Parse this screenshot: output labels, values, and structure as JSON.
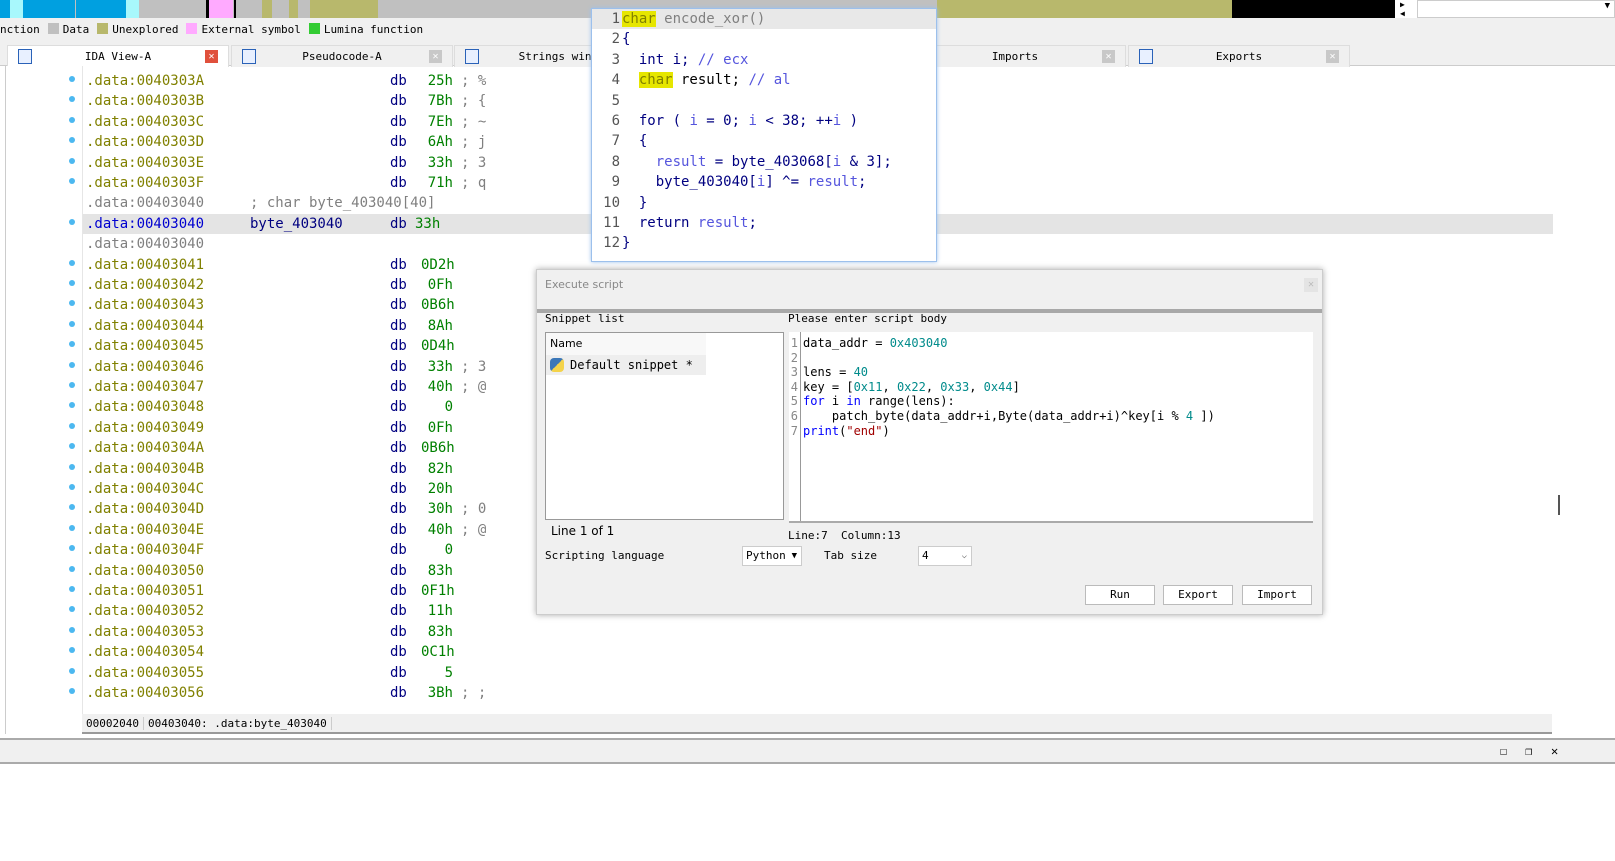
{
  "legend": [
    {
      "label": "nction",
      "color": null
    },
    {
      "label": "Data",
      "color": "#c0c0c0"
    },
    {
      "label": "Unexplored",
      "color": "#b8b86c"
    },
    {
      "label": "External symbol",
      "color": "#ffaaff"
    },
    {
      "label": "Lumina function",
      "color": "#33cc33"
    }
  ],
  "tabs": [
    {
      "label": "IDA View-A",
      "active": true
    },
    {
      "label": "Pseudocode-A"
    },
    {
      "label": "Strings window"
    },
    {
      "label": "Imports"
    },
    {
      "label": "Exports"
    }
  ],
  "listing": [
    {
      "addr": ".data:0040303A",
      "val": "25h",
      "cmt": "; %"
    },
    {
      "addr": ".data:0040303B",
      "val": "7Bh",
      "cmt": "; {"
    },
    {
      "addr": ".data:0040303C",
      "val": "7Eh",
      "cmt": "; ~"
    },
    {
      "addr": ".data:0040303D",
      "val": "6Ah",
      "cmt": "; j"
    },
    {
      "addr": ".data:0040303E",
      "val": "33h",
      "cmt": "; 3"
    },
    {
      "addr": ".data:0040303F",
      "val": "71h",
      "cmt": "; q"
    },
    {
      "addr": ".data:00403040",
      "kind": "comment",
      "text": "; char byte_403040[40]"
    },
    {
      "addr": ".data:00403040",
      "kind": "selected",
      "label": "byte_403040",
      "val": "33h"
    },
    {
      "addr": ".data:00403040",
      "kind": "blank"
    },
    {
      "addr": ".data:00403041",
      "val": "0D2h"
    },
    {
      "addr": ".data:00403042",
      "val": "0Fh"
    },
    {
      "addr": ".data:00403043",
      "val": "0B6h"
    },
    {
      "addr": ".data:00403044",
      "val": "8Ah"
    },
    {
      "addr": ".data:00403045",
      "val": "0D4h"
    },
    {
      "addr": ".data:00403046",
      "val": "33h",
      "cmt": "; 3"
    },
    {
      "addr": ".data:00403047",
      "val": "40h",
      "cmt": "; @"
    },
    {
      "addr": ".data:00403048",
      "val": "0"
    },
    {
      "addr": ".data:00403049",
      "val": "0Fh"
    },
    {
      "addr": ".data:0040304A",
      "val": "0B6h"
    },
    {
      "addr": ".data:0040304B",
      "val": "82h"
    },
    {
      "addr": ".data:0040304C",
      "val": "20h"
    },
    {
      "addr": ".data:0040304D",
      "val": "30h",
      "cmt": "; 0"
    },
    {
      "addr": ".data:0040304E",
      "val": "40h",
      "cmt": "; @"
    },
    {
      "addr": ".data:0040304F",
      "val": "0"
    },
    {
      "addr": ".data:00403050",
      "val": "83h"
    },
    {
      "addr": ".data:00403051",
      "val": "0F1h"
    },
    {
      "addr": ".data:00403052",
      "val": "11h"
    },
    {
      "addr": ".data:00403053",
      "val": "83h"
    },
    {
      "addr": ".data:00403054",
      "val": "0C1h"
    },
    {
      "addr": ".data:00403055",
      "val": "5"
    },
    {
      "addr": ".data:00403056",
      "val": "3Bh",
      "cmt": "; ;"
    }
  ],
  "db": "db",
  "status": [
    "00002040",
    "00403040: .data:byte_403040"
  ],
  "pseudocode": [
    "<span class=hl>char</span> <span style='color:#808080'>encode_xor()</span>",
    "<span class=pn>{</span>",
    "  <span class=kw>int i; </span><span class=cm>// ecx</span>",
    "  <span class=hl>char</span> result; <span class=cm>// al</span>",
    "",
    "  <span class=kw>for ( </span><span class=vr>i</span><span class=kw> = 0; </span><span class=vr>i</span><span class=kw> &lt; 38; ++</span><span class=vr>i</span><span class=kw> )</span>",
    "  <span class=kw>{</span>",
    "    <span class=vr>result</span><span class=kw> = byte_403068[</span><span class=vr>i</span><span class=kw> &amp; 3];</span>",
    "    <span class=kw>byte_403040[</span><span class=vr>i</span><span class=kw>] ^= </span><span class=vr>result</span><span class=kw>;</span>",
    "  <span class=kw>}</span>",
    "  <span class=kw>return </span><span class=vr>result</span><span class=kw>;</span>",
    "<span class=pn>}</span>"
  ],
  "dialog": {
    "title": "Execute script",
    "snippet_list_label": "Snippet list",
    "script_body_label": "Please enter script body",
    "name_header": "Name",
    "snippet": "Default snippet *",
    "line_of": "Line 1 of 1",
    "cursor": "Line:7  Column:13",
    "scripting_language_label": "Scripting language",
    "language": "Python",
    "tab_size_label": "Tab size",
    "tab_size": "4",
    "run": "Run",
    "export": "Export",
    "import": "Import",
    "script": [
      "data_addr = <span class=hx>0x403040</span>",
      "",
      "lens = <span class=hx>40</span>",
      "key = [<span class=hx>0x11</span>, <span class=hx>0x22</span>, <span class=hx>0x33</span>, <span class=hx>0x44</span>]",
      "<span class=pk>for</span> i <span class=pk>in</span> range(lens):",
      "    patch_byte(data_addr+i,Byte(data_addr+i)^key[i % <span class=hx>4</span> ])",
      "<span class=pk>print</span>(<span class=st>\"end\"</span>)"
    ]
  }
}
